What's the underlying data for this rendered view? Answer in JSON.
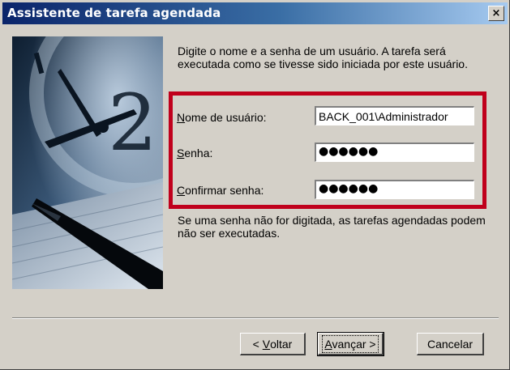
{
  "window": {
    "title": "Assistente de tarefa agendada",
    "close_symbol": "×"
  },
  "intro": "Digite o nome e a senha de um usuário. A tarefa será executada como se tivesse sido iniciada por este usuário.",
  "fields": {
    "username": {
      "label_mnemonic": "N",
      "label_rest": "ome de usuário:",
      "value": "BACK_001\\Administrador"
    },
    "password": {
      "label_mnemonic": "S",
      "label_rest": "enha:",
      "value": "●●●●●●"
    },
    "confirm": {
      "label_mnemonic": "C",
      "label_rest": "onfirmar senha:",
      "value": "●●●●●●"
    }
  },
  "note": "Se uma senha não for digitada, as tarefas agendadas podem não ser executadas.",
  "buttons": {
    "back": {
      "prefix": "< ",
      "mnemonic": "V",
      "rest": "oltar"
    },
    "next": {
      "mnemonic": "A",
      "rest": "vançar >"
    },
    "cancel": "Cancelar"
  },
  "colors": {
    "highlight_box": "#c0001c",
    "titlebar_start": "#0a246a",
    "titlebar_end": "#a6caf0"
  },
  "image": {
    "icon": "clock-and-pen-illustration"
  }
}
